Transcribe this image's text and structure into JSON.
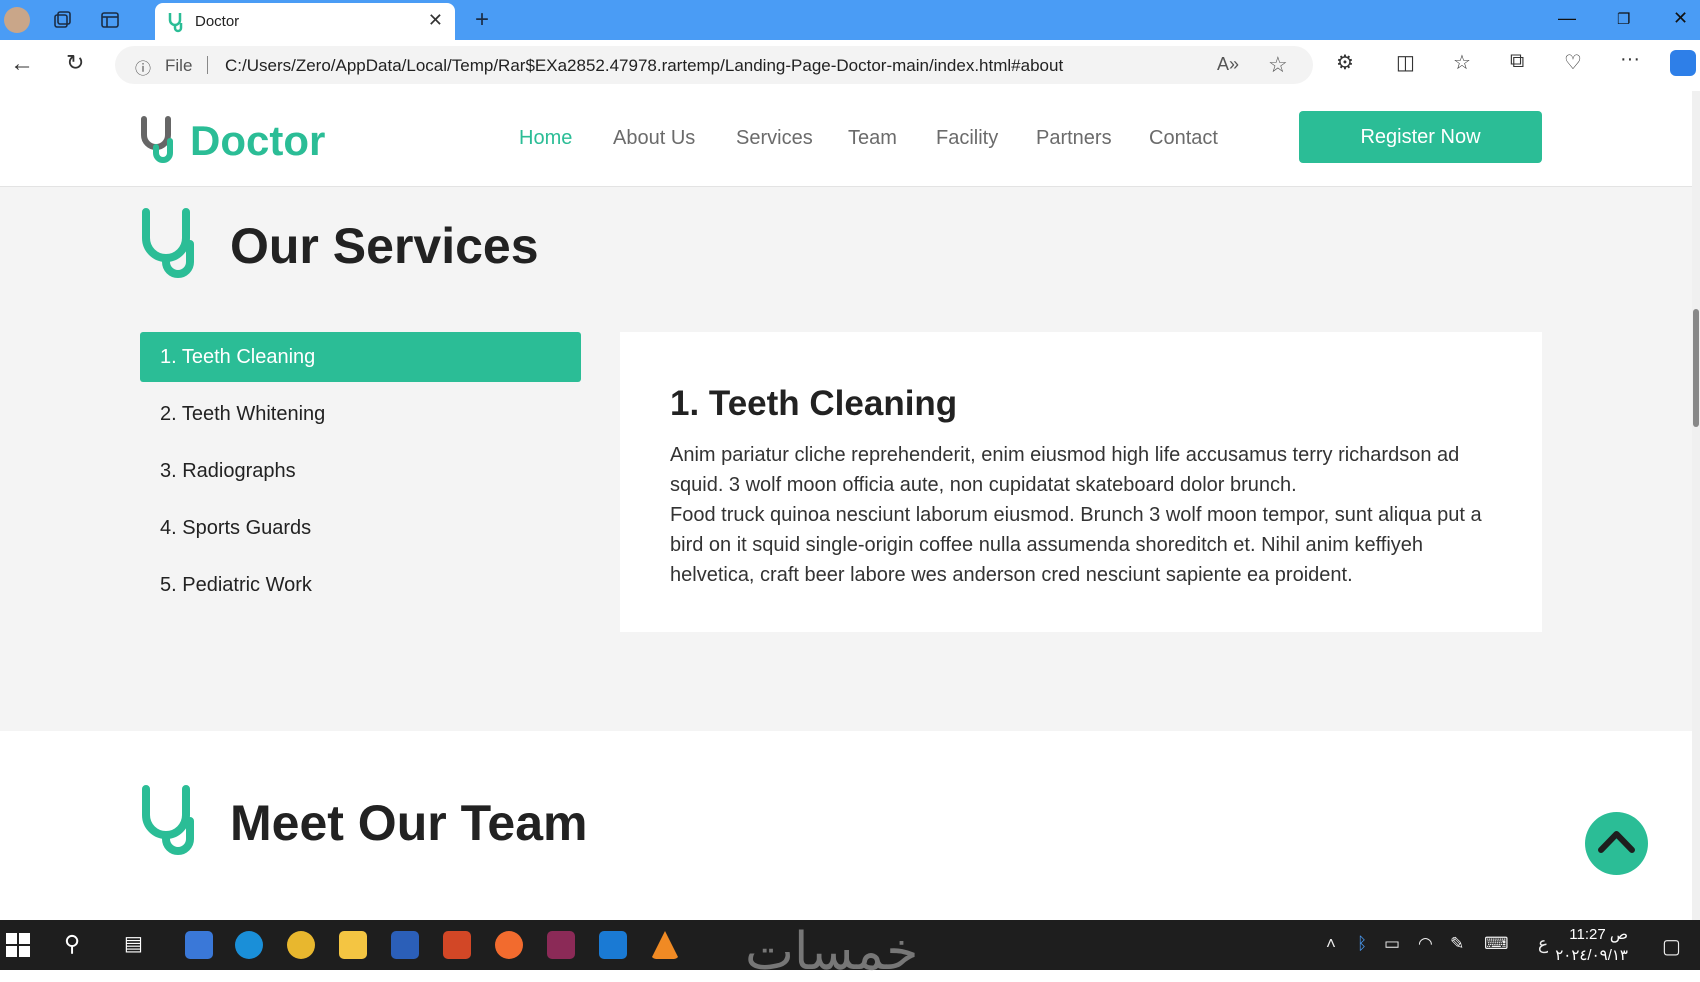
{
  "browser": {
    "tab_title": "Doctor",
    "url_prefix": "File",
    "url": "C:/Users/Zero/AppData/Local/Temp/Rar$EXa2852.47978.rartemp/Landing-Page-Doctor-main/index.html#about"
  },
  "site": {
    "logo_text": "Doctor",
    "nav": [
      "Home",
      "About Us",
      "Services",
      "Team",
      "Facility",
      "Partners",
      "Contact"
    ],
    "active_nav": "Home",
    "register_label": "Register Now"
  },
  "services": {
    "title": "Our Services",
    "items": [
      "1. Teeth Cleaning",
      "2. Teeth Whitening",
      "3. Radiographs",
      "4. Sports Guards",
      "5. Pediatric Work"
    ],
    "active_item": "1. Teeth Cleaning",
    "detail_title": "1. Teeth Cleaning",
    "detail_p1": "Anim pariatur cliche reprehenderit, enim eiusmod high life accusamus terry richardson ad squid. 3 wolf moon officia aute, non cupidatat skateboard dolor brunch.",
    "detail_p2": "Food truck quinoa nesciunt laborum eiusmod. Brunch 3 wolf moon tempor, sunt aliqua put a bird on it squid single-origin coffee nulla assumenda shoreditch et. Nihil anim keffiyeh helvetica, craft beer labore wes anderson cred nesciunt sapiente ea proident."
  },
  "team": {
    "title": "Meet Our Team"
  },
  "taskbar": {
    "watermark": "خمسات",
    "lang": "ع",
    "time": "11:27 ص",
    "date": "٢٠٢٤/٠٩/١٣"
  },
  "colors": {
    "brand": "#2bbd96",
    "titlebar": "#4a9cf5"
  }
}
